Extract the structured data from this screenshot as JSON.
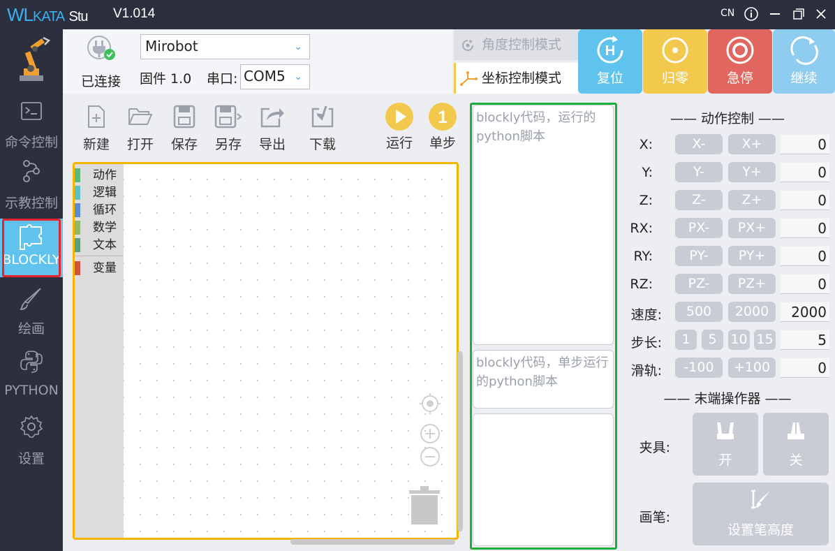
{
  "app": {
    "logo_primary": "WL",
    "logo_secondary": "KATA",
    "logo_tail": "Stu",
    "version": "V1.014",
    "lang": "CN"
  },
  "sidebar": {
    "items": [
      {
        "label": "命令控制",
        "icon": "terminal-icon"
      },
      {
        "label": "示教控制",
        "icon": "flow-icon"
      },
      {
        "label": "BLOCKLY",
        "icon": "puzzle-icon"
      },
      {
        "label": "绘画",
        "icon": "brush-icon"
      },
      {
        "label": "PYTHON",
        "icon": "python-icon"
      },
      {
        "label": "设置",
        "icon": "gear-icon"
      }
    ]
  },
  "connection": {
    "device": "Mirobot",
    "status": "已连接",
    "firmware": "固件 1.0",
    "port_label": "串口:",
    "port_value": "COM5"
  },
  "modes": {
    "angle": "角度控制模式",
    "coord": "坐标控制模式"
  },
  "actions": {
    "reset": "复位",
    "home": "归零",
    "estop": "急停",
    "resume": "继续"
  },
  "colors": {
    "reset": "#5fc3ee",
    "home": "#f2c94c",
    "estop": "#e0665f",
    "resume": "#8fcdf0"
  },
  "toolbar": {
    "new": "新建",
    "open": "打开",
    "save": "保存",
    "save_as": "另存",
    "export": "导出",
    "download": "下载",
    "run": "运行",
    "step": "单步",
    "step_number": "1"
  },
  "toolbox": {
    "categories": [
      {
        "label": "动作",
        "color": "#5cb87a"
      },
      {
        "label": "逻辑",
        "color": "#5bc0bf"
      },
      {
        "label": "循环",
        "color": "#5b8ccc"
      },
      {
        "label": "数学",
        "color": "#8fb86a"
      },
      {
        "label": "文本",
        "color": "#5ba07d"
      },
      {
        "label": "变量",
        "color": "#d0523f"
      }
    ]
  },
  "code": {
    "run_placeholder": "blockly代码，运行的python脚本",
    "step_placeholder": "blockly代码，单步运行的python脚本"
  },
  "control": {
    "title": "动作控制",
    "axes": [
      {
        "label": "X:",
        "minus": "X-",
        "plus": "X+",
        "value": "0"
      },
      {
        "label": "Y:",
        "minus": "Y-",
        "plus": "Y+",
        "value": "0"
      },
      {
        "label": "Z:",
        "minus": "Z-",
        "plus": "Z+",
        "value": "0"
      },
      {
        "label": "RX:",
        "minus": "PX-",
        "plus": "PX+",
        "value": "0"
      },
      {
        "label": "RY:",
        "minus": "PY-",
        "plus": "PY+",
        "value": "0"
      },
      {
        "label": "RZ:",
        "minus": "PZ-",
        "plus": "PZ+",
        "value": "0"
      }
    ],
    "speed_label": "速度:",
    "speed_a": "500",
    "speed_b": "2000",
    "speed_value": "2000",
    "step_label": "步长:",
    "steps": [
      "1",
      "5",
      "10",
      "15"
    ],
    "step_value": "5",
    "rail_label": "滑轨:",
    "rail_minus": "-100",
    "rail_plus": "+100",
    "rail_value": "0"
  },
  "end_effector": {
    "title": "末端操作器",
    "gripper_label": "夹具:",
    "open": "开",
    "close": "关",
    "pen_label": "画笔:",
    "pen_button": "设置笔高度"
  }
}
